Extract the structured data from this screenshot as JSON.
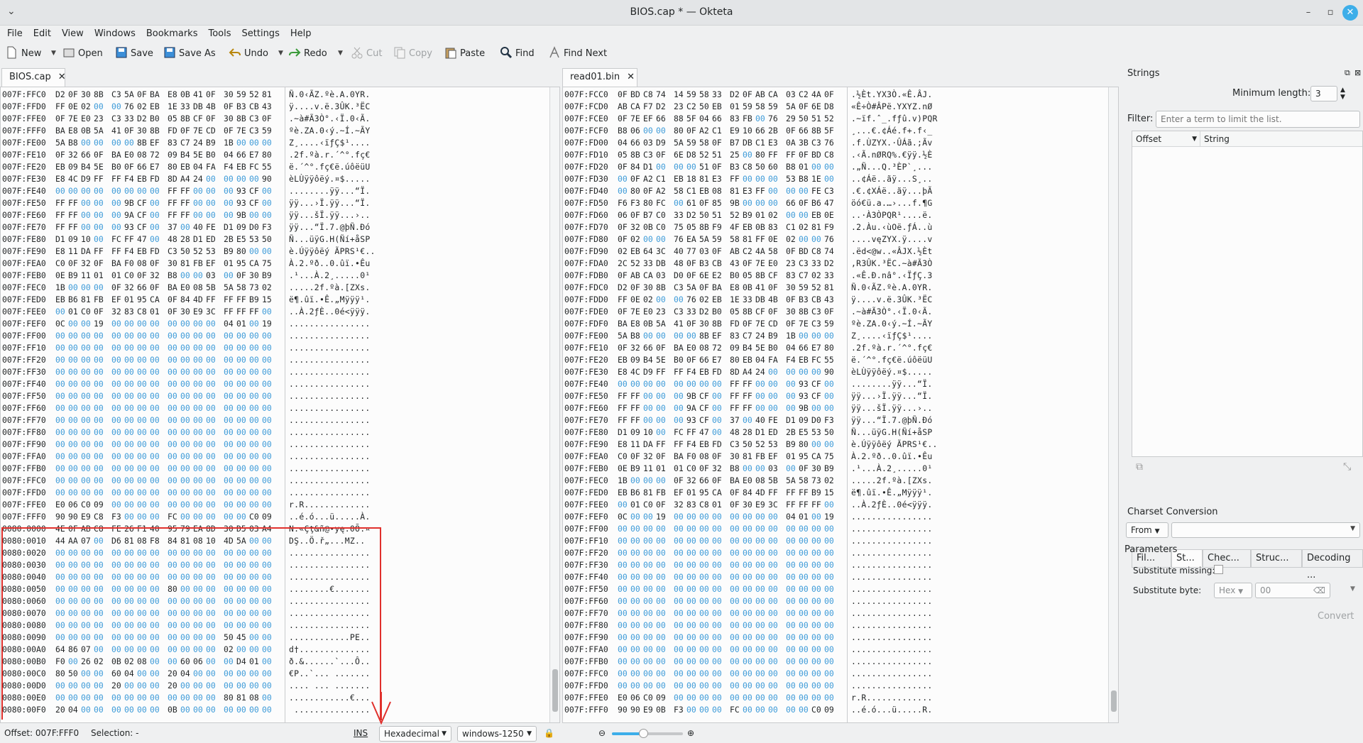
{
  "window": {
    "title": "BIOS.cap * — Okteta"
  },
  "menu": [
    "File",
    "Edit",
    "View",
    "Windows",
    "Bookmarks",
    "Tools",
    "Settings",
    "Help"
  ],
  "toolbar": {
    "new": "New",
    "open": "Open",
    "save": "Save",
    "save_as": "Save As",
    "undo": "Undo",
    "redo": "Redo",
    "cut": "Cut",
    "copy": "Copy",
    "paste": "Paste",
    "find": "Find",
    "find_next": "Find Next"
  },
  "tabs": {
    "left": "BIOS.cap",
    "right": "read01.bin"
  },
  "left_rows": [
    {
      "o": "007F:FFC0",
      "h": "D2 0F 30 8B C3 5A 0F BA E8 0B 41 0F 30 59 52 81",
      "t": "Ñ.0‹ÃZ.ºè.A.0YR."
    },
    {
      "o": "007F:FFD0",
      "h": "FF 0E 02 00 00 76 02 EB 1E 33 DB 4B 0F B3 CB 43",
      "t": "ÿ....v.ë.3ÛK.³ËC"
    },
    {
      "o": "007F:FFE0",
      "h": "0F 7E E0 23 C3 33 D2 B0 05 8B CF 0F 30 8B C3 0F",
      "t": ".~à#Ã3Ò°.‹Ï.0‹Ã."
    },
    {
      "o": "007F:FFF0",
      "h": "BA E8 0B 5A 41 0F 30 8B FD 0F 7E CD 0F 7E C3 59",
      "t": "ºè.ZA.0‹ý.~Í.~ÃY"
    },
    {
      "o": "007F:FE00",
      "h": "5A B8 00 00 00 00 8B EF 83 C7 24 B9 1B 00 00 00",
      "t": "Z¸....‹ïƒÇ$¹...."
    },
    {
      "o": "007F:FE10",
      "h": "0F 32 66 0F BA E0 08 72 09 B4 5E B0 04 66 E7 80",
      "t": ".2f.ºà.r.´^°.fç€"
    },
    {
      "o": "007F:FE20",
      "h": "EB 09 B4 5E B0 0F 66 E7 80 EB 04 FA F4 EB FC 55",
      "t": "ë.´^°.fç€ë.úôëüU"
    },
    {
      "o": "007F:FE30",
      "h": "E8 4C D9 FF FF F4 EB FD 8D A4 24 00 00 00 00 90",
      "t": "èLÙÿÿôëý.¤$....."
    },
    {
      "o": "007F:FE40",
      "h": "00 00 00 00 00 00 00 00 FF FF 00 00 00 93 CF 00",
      "t": "........ÿÿ...“Ï."
    },
    {
      "o": "007F:FE50",
      "h": "FF FF 00 00 00 9B CF 00 FF FF 00 00 00 93 CF 00",
      "t": "ÿÿ...›Ï.ÿÿ...“Ï."
    },
    {
      "o": "007F:FE60",
      "h": "FF FF 00 00 00 9A CF 00 FF FF 00 00 00 9B 00 00",
      "t": "ÿÿ...šÏ.ÿÿ...›.."
    },
    {
      "o": "007F:FE70",
      "h": "FF FF 00 00 00 93 CF 00 37 00 40 FE D1 09 D0 F3",
      "t": "ÿÿ...“Ï.7.@þÑ.Ðó"
    },
    {
      "o": "007F:FE80",
      "h": "D1 09 10 00 FC FF 47 00 48 28 D1 ED 2B E5 53 50",
      "t": "Ñ...üÿG.H(Ñí+åSP"
    },
    {
      "o": "007F:FE90",
      "h": "E8 11 DA FF FF F4 EB FD C3 50 52 53 B9 80 00 00",
      "t": "è.Úÿÿôëý ÃPRS¹€.."
    },
    {
      "o": "007F:FEA0",
      "h": "C0 0F 32 0F BA F0 08 0F 30 81 FB EF 01 95 CA 75",
      "t": "À.2.ºð..0.ûï.•Êu"
    },
    {
      "o": "007F:FEB0",
      "h": "0E B9 11 01 01 C0 0F 32 B8 00 00 03 00 0F 30 B9",
      "t": ".¹...À.2¸.....0¹"
    },
    {
      "o": "007F:FEC0",
      "h": "1B 00 00 00 0F 32 66 0F BA E0 08 5B 5A 58 73 02",
      "t": ".....2f.ºà.[ZXs."
    },
    {
      "o": "007F:FED0",
      "h": "EB B6 81 FB EF 01 95 CA 0F 84 4D FF FF FF B9 15",
      "t": "ë¶.ûï.•Ê.„Mÿÿÿ¹."
    },
    {
      "o": "007F:FEE0",
      "h": "00 01 C0 0F 32 83 C8 01 0F 30 E9 3C FF FF FF 00",
      "t": "..À.2ƒÈ..0é<ÿÿÿ."
    },
    {
      "o": "007F:FEF0",
      "h": "0C 00 00 19 00 00 00 00 00 00 00 00 04 01 00 19",
      "t": "................"
    },
    {
      "o": "007F:FF00",
      "h": "00 00 00 00 00 00 00 00 00 00 00 00 00 00 00 00",
      "t": "................"
    },
    {
      "o": "007F:FF10",
      "h": "00 00 00 00 00 00 00 00 00 00 00 00 00 00 00 00",
      "t": "................"
    },
    {
      "o": "007F:FF20",
      "h": "00 00 00 00 00 00 00 00 00 00 00 00 00 00 00 00",
      "t": "................"
    },
    {
      "o": "007F:FF30",
      "h": "00 00 00 00 00 00 00 00 00 00 00 00 00 00 00 00",
      "t": "................"
    },
    {
      "o": "007F:FF40",
      "h": "00 00 00 00 00 00 00 00 00 00 00 00 00 00 00 00",
      "t": "................"
    },
    {
      "o": "007F:FF50",
      "h": "00 00 00 00 00 00 00 00 00 00 00 00 00 00 00 00",
      "t": "................"
    },
    {
      "o": "007F:FF60",
      "h": "00 00 00 00 00 00 00 00 00 00 00 00 00 00 00 00",
      "t": "................"
    },
    {
      "o": "007F:FF70",
      "h": "00 00 00 00 00 00 00 00 00 00 00 00 00 00 00 00",
      "t": "................"
    },
    {
      "o": "007F:FF80",
      "h": "00 00 00 00 00 00 00 00 00 00 00 00 00 00 00 00",
      "t": "................"
    },
    {
      "o": "007F:FF90",
      "h": "00 00 00 00 00 00 00 00 00 00 00 00 00 00 00 00",
      "t": "................"
    },
    {
      "o": "007F:FFA0",
      "h": "00 00 00 00 00 00 00 00 00 00 00 00 00 00 00 00",
      "t": "................"
    },
    {
      "o": "007F:FFB0",
      "h": "00 00 00 00 00 00 00 00 00 00 00 00 00 00 00 00",
      "t": "................"
    },
    {
      "o": "007F:FFC0",
      "h": "00 00 00 00 00 00 00 00 00 00 00 00 00 00 00 00",
      "t": "................"
    },
    {
      "o": "007F:FFD0",
      "h": "00 00 00 00 00 00 00 00 00 00 00 00 00 00 00 00",
      "t": "................"
    },
    {
      "o": "007F:FFE0",
      "h": "E0 06 C0 09 00 00 00 00 00 00 00 00 00 00 00 00",
      "t": "r.R............."
    },
    {
      "o": "007F:FFF0",
      "h": "90 90 E9 C8 F3 00 00 00 FC 00 00 00 00 00 C0 09",
      "t": "..é.ó...ü.....À."
    },
    {
      "o": "0080:0000",
      "h": "4E 0F AB C8 FE 26 F1 40 95 79 EA 8D 30 D5 03 A4",
      "t": "N.«Çţ&ñ@•yę.0Õ.¤"
    },
    {
      "o": "0080:0010",
      "h": "44 AA 07 00 D6 81 08 F8 84 81 08 10 4D 5A 00 00",
      "t": "DŞ..Ö.ř„...MZ.."
    },
    {
      "o": "0080:0020",
      "h": "00 00 00 00 00 00 00 00 00 00 00 00 00 00 00 00",
      "t": "................"
    },
    {
      "o": "0080:0030",
      "h": "00 00 00 00 00 00 00 00 00 00 00 00 00 00 00 00",
      "t": "................"
    },
    {
      "o": "0080:0040",
      "h": "00 00 00 00 00 00 00 00 00 00 00 00 00 00 00 00",
      "t": "................"
    },
    {
      "o": "0080:0050",
      "h": "00 00 00 00 00 00 00 00 80 00 00 00 00 00 00 00",
      "t": "........€......."
    },
    {
      "o": "0080:0060",
      "h": "00 00 00 00 00 00 00 00 00 00 00 00 00 00 00 00",
      "t": "................"
    },
    {
      "o": "0080:0070",
      "h": "00 00 00 00 00 00 00 00 00 00 00 00 00 00 00 00",
      "t": "................"
    },
    {
      "o": "0080:0080",
      "h": "00 00 00 00 00 00 00 00 00 00 00 00 00 00 00 00",
      "t": "................"
    },
    {
      "o": "0080:0090",
      "h": "00 00 00 00 00 00 00 00 00 00 00 00 50 45 00 00",
      "t": "............PE.."
    },
    {
      "o": "0080:00A0",
      "h": "64 86 07 00 00 00 00 00 00 00 00 00 02 00 00 00",
      "t": "d†.............."
    },
    {
      "o": "0080:00B0",
      "h": "F0 00 26 02 0B 02 08 00 00 60 06 00 00 D4 01 00",
      "t": "ð.&......`...Ô.."
    },
    {
      "o": "0080:00C0",
      "h": "80 50 00 00 60 04 00 00 20 04 00 00 00 00 00 00",
      "t": "€P..`... ......."
    },
    {
      "o": "0080:00D0",
      "h": "00 00 00 00 20 00 00 00 20 00 00 00 00 00 00 00",
      "t": ".... ... ......."
    },
    {
      "o": "0080:00E0",
      "h": "00 00 00 00 00 00 00 00 00 00 00 00 80 81 08 00",
      "t": "............€..."
    },
    {
      "o": "0080:00F0",
      "h": "20 04 00 00 00 00 00 00 0B 00 00 00 00 00 00 00",
      "t": " ..............."
    }
  ],
  "right_rows": [
    {
      "o": "007F:FCC0",
      "h": "0F BD C8 74 14 59 58 33 D2 0F AB CA 03 C2 4A 0F",
      "t": ".½Èt.YX3Ò.«Ê.ÂJ."
    },
    {
      "o": "007F:FCD0",
      "h": "AB CA F7 D2 23 C2 50 EB 01 59 58 59 5A 0F 6E D8",
      "t": "«Ê÷Ò#ÂPë.YXYZ.nØ"
    },
    {
      "o": "007F:FCE0",
      "h": "0F 7E EF 66 88 5F 04 66 83 FB 00 76 29 50 51 52",
      "t": ".~ïf.ˆ_.fƒû.v)PQR"
    },
    {
      "o": "007F:FCF0",
      "h": "B8 06 00 00 80 0F A2 C1 E9 10 66 2B 0F 66 8B 5F",
      "t": "¸...€.¢Áé.f+.f‹_"
    },
    {
      "o": "007F:FD00",
      "h": "04 66 03 D9 5A 59 58 0F B7 DB C1 E3 0A 3B C3 76",
      "t": ".f.ÙZYX.·ÛÁã.;Ãv"
    },
    {
      "o": "007F:FD10",
      "h": "05 8B C3 0F 6E D8 52 51 25 00 80 FF FF 0F BD C8",
      "t": ".‹Ã.nØRQ%.€ÿÿ.½È"
    },
    {
      "o": "007F:FD20",
      "h": "0F 84 D1 00 00 00 51 0F B3 C8 50 60 B8 01 00 00",
      "t": ".„Ñ...Q.³ÈP`¸..."
    },
    {
      "o": "007F:FD30",
      "h": "00 0F A2 C1 EB 18 81 E3 FF 00 00 00 53 B8 1E 00",
      "t": "..¢Áë..ãÿ...S¸.."
    },
    {
      "o": "007F:FD40",
      "h": "00 80 0F A2 58 C1 EB 08 81 E3 FF 00 00 00 FE C3",
      "t": ".€.¢XÁë..ãÿ...þÃ"
    },
    {
      "o": "007F:FD50",
      "h": "F6 F3 80 FC 00 61 0F 85 9B 00 00 00 66 0F B6 47",
      "t": "öó€ü.a.…›...f.¶G"
    },
    {
      "o": "007F:FD60",
      "h": "06 0F B7 C0 33 D2 50 51 52 B9 01 02 00 00 EB 0E",
      "t": "..·À3ÒPQR¹....ë."
    },
    {
      "o": "007F:FD70",
      "h": "0F 32 0B C0 75 05 8B F9 4F EB 0B 83 C1 02 81 F9",
      "t": ".2.Àu.‹ùOë.ƒÁ..ù"
    },
    {
      "o": "007F:FD80",
      "h": "0F 02 00 00 76 EA 5A 59 58 81 FF 0E 02 00 00 76",
      "t": "....vęZYX.ÿ....v"
    },
    {
      "o": "007F:FD90",
      "h": "02 EB 64 3C 40 77 03 0F AB C2 4A 58 0F BD C8 74",
      "t": ".ëd<@w..«ÂJX.½Èt"
    },
    {
      "o": "007F:FDA0",
      "h": "2C 52 33 DB 48 0F B3 CB 43 0F 7E E0 23 C3 33 D2",
      "t": ",R3ÛK.³ËC.~à#Ã3Ò"
    },
    {
      "o": "007F:FDB0",
      "h": "0F AB CA 03 D0 0F 6E E2 B0 05 8B CF 83 C7 02 33",
      "t": ".«Ê.Ð.nâ°.‹ÏƒÇ.3"
    },
    {
      "o": "007F:FDC0",
      "h": "D2 0F 30 8B C3 5A 0F BA E8 0B 41 0F 30 59 52 81",
      "t": "Ñ.0‹ÃZ.ºè.A.0YR."
    },
    {
      "o": "007F:FDD0",
      "h": "FF 0E 02 00 00 76 02 EB 1E 33 DB 4B 0F B3 CB 43",
      "t": "ÿ....v.ë.3ÛK.³ËC"
    },
    {
      "o": "007F:FDE0",
      "h": "0F 7E E0 23 C3 33 D2 B0 05 8B CF 0F 30 8B C3 0F",
      "t": ".~à#Ã3Ò°.‹Ï.0‹Ã."
    },
    {
      "o": "007F:FDF0",
      "h": "BA E8 0B 5A 41 0F 30 8B FD 0F 7E CD 0F 7E C3 59",
      "t": "ºè.ZA.0‹ý.~Í.~ÃY"
    },
    {
      "o": "007F:FE00",
      "h": "5A B8 00 00 00 00 8B EF 83 C7 24 B9 1B 00 00 00",
      "t": "Z¸....‹ïƒÇ$¹...."
    },
    {
      "o": "007F:FE10",
      "h": "0F 32 66 0F BA E0 08 72 09 B4 5E B0 04 66 E7 80",
      "t": ".2f.ºà.r.´^°.fç€"
    },
    {
      "o": "007F:FE20",
      "h": "EB 09 B4 5E B0 0F 66 E7 80 EB 04 FA F4 EB FC 55",
      "t": "ë.´^°.fç€ë.úôëüU"
    },
    {
      "o": "007F:FE30",
      "h": "E8 4C D9 FF FF F4 EB FD 8D A4 24 00 00 00 00 90",
      "t": "èLÙÿÿôëý.¤$....."
    },
    {
      "o": "007F:FE40",
      "h": "00 00 00 00 00 00 00 00 FF FF 00 00 00 93 CF 00",
      "t": "........ÿÿ...“Ï."
    },
    {
      "o": "007F:FE50",
      "h": "FF FF 00 00 00 9B CF 00 FF FF 00 00 00 93 CF 00",
      "t": "ÿÿ...›Ï.ÿÿ...“Ï."
    },
    {
      "o": "007F:FE60",
      "h": "FF FF 00 00 00 9A CF 00 FF FF 00 00 00 9B 00 00",
      "t": "ÿÿ...šÏ.ÿÿ...›.."
    },
    {
      "o": "007F:FE70",
      "h": "FF FF 00 00 00 93 CF 00 37 00 40 FE D1 09 D0 F3",
      "t": "ÿÿ...“Ï.7.@þÑ.Ðó"
    },
    {
      "o": "007F:FE80",
      "h": "D1 09 10 00 FC FF 47 00 48 28 D1 ED 2B E5 53 50",
      "t": "Ñ...üÿG.H(Ñí+åSP"
    },
    {
      "o": "007F:FE90",
      "h": "E8 11 DA FF FF F4 EB FD C3 50 52 53 B9 80 00 00",
      "t": "è.Úÿÿôëý ÃPRS¹€.."
    },
    {
      "o": "007F:FEA0",
      "h": "C0 0F 32 0F BA F0 08 0F 30 81 FB EF 01 95 CA 75",
      "t": "À.2.ºð..0.ûï.•Êu"
    },
    {
      "o": "007F:FEB0",
      "h": "0E B9 11 01 01 C0 0F 32 B8 00 00 03 00 0F 30 B9",
      "t": ".¹...À.2¸.....0¹"
    },
    {
      "o": "007F:FEC0",
      "h": "1B 00 00 00 0F 32 66 0F BA E0 08 5B 5A 58 73 02",
      "t": ".....2f.ºà.[ZXs."
    },
    {
      "o": "007F:FED0",
      "h": "EB B6 81 FB EF 01 95 CA 0F 84 4D FF FF FF B9 15",
      "t": "ë¶.ûï.•Ê.„Mÿÿÿ¹."
    },
    {
      "o": "007F:FEE0",
      "h": "00 01 C0 0F 32 83 C8 01 0F 30 E9 3C FF FF FF 00",
      "t": "..À.2ƒÈ..0é<ÿÿÿ."
    },
    {
      "o": "007F:FEF0",
      "h": "0C 00 00 19 00 00 00 00 00 00 00 00 04 01 00 19",
      "t": "................"
    },
    {
      "o": "007F:FF00",
      "h": "00 00 00 00 00 00 00 00 00 00 00 00 00 00 00 00",
      "t": "................"
    },
    {
      "o": "007F:FF10",
      "h": "00 00 00 00 00 00 00 00 00 00 00 00 00 00 00 00",
      "t": "................"
    },
    {
      "o": "007F:FF20",
      "h": "00 00 00 00 00 00 00 00 00 00 00 00 00 00 00 00",
      "t": "................"
    },
    {
      "o": "007F:FF30",
      "h": "00 00 00 00 00 00 00 00 00 00 00 00 00 00 00 00",
      "t": "................"
    },
    {
      "o": "007F:FF40",
      "h": "00 00 00 00 00 00 00 00 00 00 00 00 00 00 00 00",
      "t": "................"
    },
    {
      "o": "007F:FF50",
      "h": "00 00 00 00 00 00 00 00 00 00 00 00 00 00 00 00",
      "t": "................"
    },
    {
      "o": "007F:FF60",
      "h": "00 00 00 00 00 00 00 00 00 00 00 00 00 00 00 00",
      "t": "................"
    },
    {
      "o": "007F:FF70",
      "h": "00 00 00 00 00 00 00 00 00 00 00 00 00 00 00 00",
      "t": "................"
    },
    {
      "o": "007F:FF80",
      "h": "00 00 00 00 00 00 00 00 00 00 00 00 00 00 00 00",
      "t": "................"
    },
    {
      "o": "007F:FF90",
      "h": "00 00 00 00 00 00 00 00 00 00 00 00 00 00 00 00",
      "t": "................"
    },
    {
      "o": "007F:FFA0",
      "h": "00 00 00 00 00 00 00 00 00 00 00 00 00 00 00 00",
      "t": "................"
    },
    {
      "o": "007F:FFB0",
      "h": "00 00 00 00 00 00 00 00 00 00 00 00 00 00 00 00",
      "t": "................"
    },
    {
      "o": "007F:FFC0",
      "h": "00 00 00 00 00 00 00 00 00 00 00 00 00 00 00 00",
      "t": "................"
    },
    {
      "o": "007F:FFD0",
      "h": "00 00 00 00 00 00 00 00 00 00 00 00 00 00 00 00",
      "t": "................"
    },
    {
      "o": "007F:FFE0",
      "h": "E0 06 C0 09 00 00 00 00 00 00 00 00 00 00 00 00",
      "t": "r.R............."
    },
    {
      "o": "007F:FFF0",
      "h": "90 90 E9 0B F3 00 00 00 FC 00 00 00 00 00 C0 09",
      "t": "..é.ó...ü.....R."
    }
  ],
  "sidebar": {
    "strings_title": "Strings",
    "min_length_label": "Minimum length:",
    "min_length_value": "3",
    "filter_label": "Filter:",
    "filter_placeholder": "Enter a term to limit the list.",
    "col_offset": "Offset",
    "col_string": "String",
    "tabs": [
      "Fil...",
      "St...",
      "Chec...",
      "Struc...",
      "Decoding ..."
    ],
    "charset_title": "Charset Conversion",
    "from_label": "From",
    "parameters_label": "Parameters",
    "sub_missing_label": "Substitute missing:",
    "sub_byte_label": "Substitute byte:",
    "sub_byte_format": "Hex",
    "sub_byte_value": "00",
    "convert_label": "Convert"
  },
  "status": {
    "offset": "Offset: 007F:FFF0",
    "selection": "Selection: -",
    "ins": "INS",
    "encoding_mode": "Hexadecimal",
    "charset": "windows-1250"
  }
}
